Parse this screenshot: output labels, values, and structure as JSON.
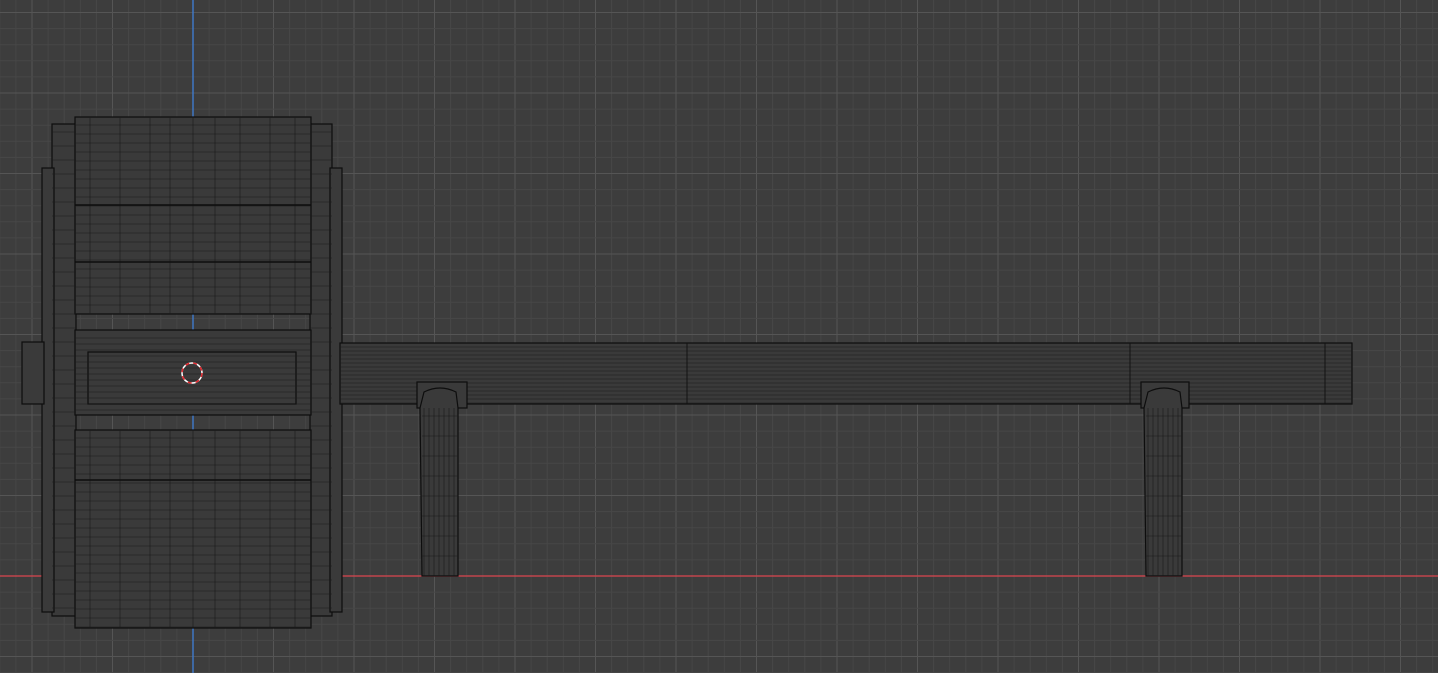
{
  "viewport": {
    "background": "#3d3d3d",
    "grid_minor_color": "#474747",
    "grid_major_color": "#555555",
    "x_axis_color": "#c2454d",
    "y_axis_color": "#3f77c4",
    "mesh_wire_color": "#111111",
    "cursor_colors": [
      "#e0262d",
      "#ffffff"
    ]
  },
  "icons": {
    "cursor": "3d-cursor-icon"
  }
}
